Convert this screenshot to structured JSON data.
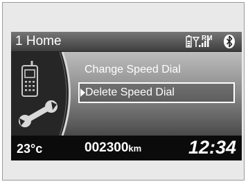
{
  "header": {
    "title": "1 Home",
    "rm_badge": "RM",
    "icons": [
      "phone-battery-icon",
      "signal-strength-icon",
      "bluetooth-icon"
    ]
  },
  "menu": {
    "items": [
      {
        "label": "Change Speed Dial",
        "selected": false
      },
      {
        "label": "Delete Speed Dial",
        "selected": true
      }
    ],
    "side_icon": "phone-wrench-icon"
  },
  "footer": {
    "temperature": "23°c",
    "odometer": "002300",
    "odometer_unit": "km",
    "clock": "12:34"
  },
  "colors": {
    "screen_bg": "#0c0c0c",
    "text": "#ffffff",
    "selection_border": "#ffffff"
  }
}
